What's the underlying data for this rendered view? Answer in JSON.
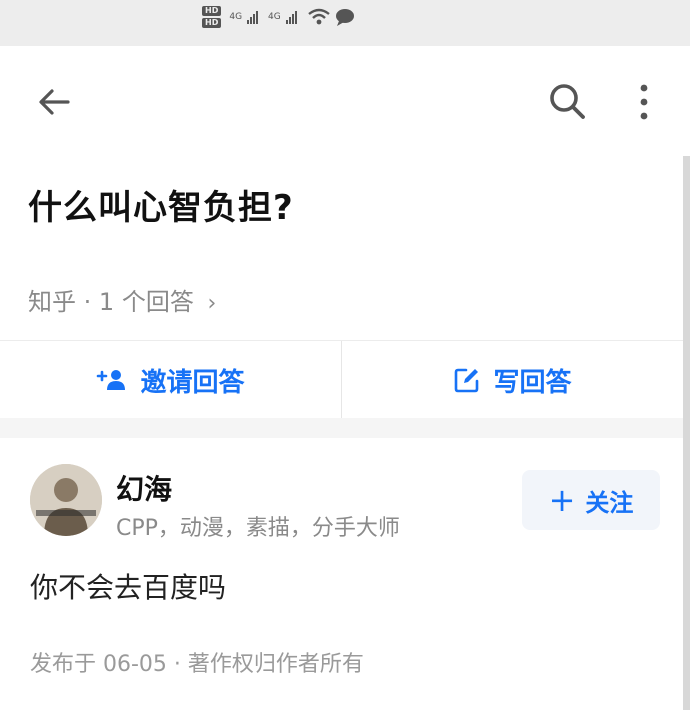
{
  "status_bar": {
    "hd1": "HD",
    "hd2": "HD",
    "net1": "4G",
    "net2": "4G"
  },
  "header": {
    "back": "back-arrow-icon",
    "search": "search-icon",
    "more": "more-vertical-icon"
  },
  "question": {
    "title": "什么叫心智负担?",
    "source": "知乎",
    "separator": "·",
    "answer_count": "1 个回答",
    "chevron": "›"
  },
  "actions": {
    "invite_label": "邀请回答",
    "write_label": "写回答",
    "accent": "#1772f6"
  },
  "answer": {
    "author_name": "幻海",
    "author_bio": "CPP，动漫，素描，分手大师",
    "follow_plus": "+",
    "follow_label": "关注",
    "content": "你不会去百度吗",
    "meta": "发布于 06-05 · 著作权归作者所有"
  }
}
